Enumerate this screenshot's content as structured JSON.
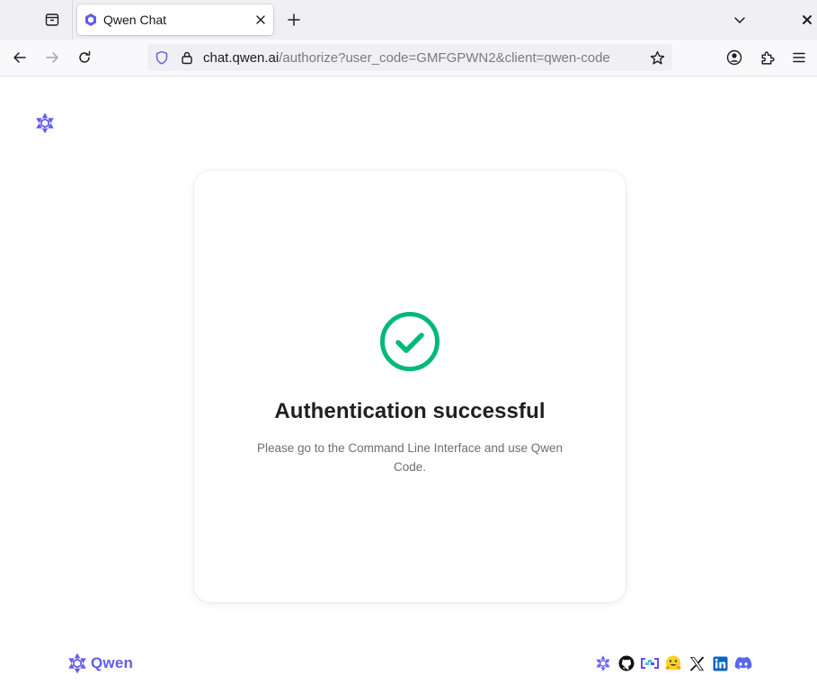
{
  "browser": {
    "tab": {
      "title": "Qwen Chat"
    },
    "url": {
      "host": "chat.qwen.ai",
      "path": "/authorize?user_code=GMFGPWN2&client=qwen-code"
    }
  },
  "card": {
    "title": "Authentication successful",
    "message": "Please go to the Command Line Interface and use Qwen Code.",
    "check_color": "#00b87a"
  },
  "footer": {
    "brand_name": "Qwen",
    "brand_color": "#615ced",
    "social_icons": [
      "qwen-icon",
      "github-icon",
      "modelscope-icon",
      "huggingface-icon",
      "x-icon",
      "linkedin-icon",
      "discord-icon"
    ]
  }
}
